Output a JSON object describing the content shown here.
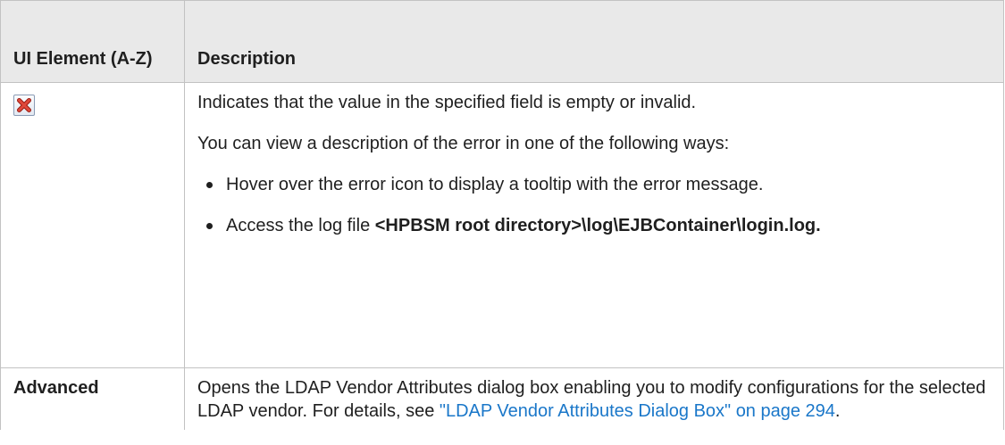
{
  "table": {
    "header": {
      "col1": "UI Element (A-Z)",
      "col2": "Description"
    },
    "rows": {
      "error": {
        "icon": "error-x-icon",
        "intro": "Indicates that the value in the specified field is empty or invalid.",
        "ways": "You can view a description of the error in one of the following ways:",
        "bullet1": "Hover over the error icon to display a tooltip with the error message.",
        "bullet2_prefix": "Access the log file ",
        "bullet2_path": "<HPBSM root directory>\\log\\EJBContainer\\login.log."
      },
      "advanced": {
        "element": "Advanced",
        "description": "Opens the LDAP Vendor Attributes dialog box enabling you to modify configurations for the selected LDAP vendor. For details, see ",
        "link": "\"LDAP Vendor Attributes Dialog Box\" on page 294",
        "suffix": "."
      }
    }
  },
  "colors": {
    "header_bg": "#e9e9e9",
    "border": "#c2c2c2",
    "link": "#1a77c9",
    "icon_red": "#d9372b"
  }
}
